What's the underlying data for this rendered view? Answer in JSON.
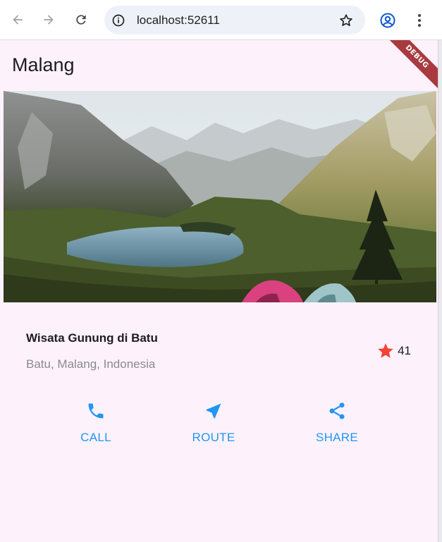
{
  "browser": {
    "url": "localhost:52611"
  },
  "app": {
    "title": "Malang",
    "debug_banner": "DEBUG"
  },
  "place": {
    "title": "Wisata Gunung di Batu",
    "subtitle": "Batu, Malang, Indonesia",
    "rating": "41",
    "star_color": "#f44336"
  },
  "actions": [
    {
      "label": "CALL",
      "icon": "phone-icon"
    },
    {
      "label": "ROUTE",
      "icon": "navigation-icon"
    },
    {
      "label": "SHARE",
      "icon": "share-icon"
    }
  ],
  "colors": {
    "accent": "#2196f3",
    "background": "#fdf2fb"
  }
}
